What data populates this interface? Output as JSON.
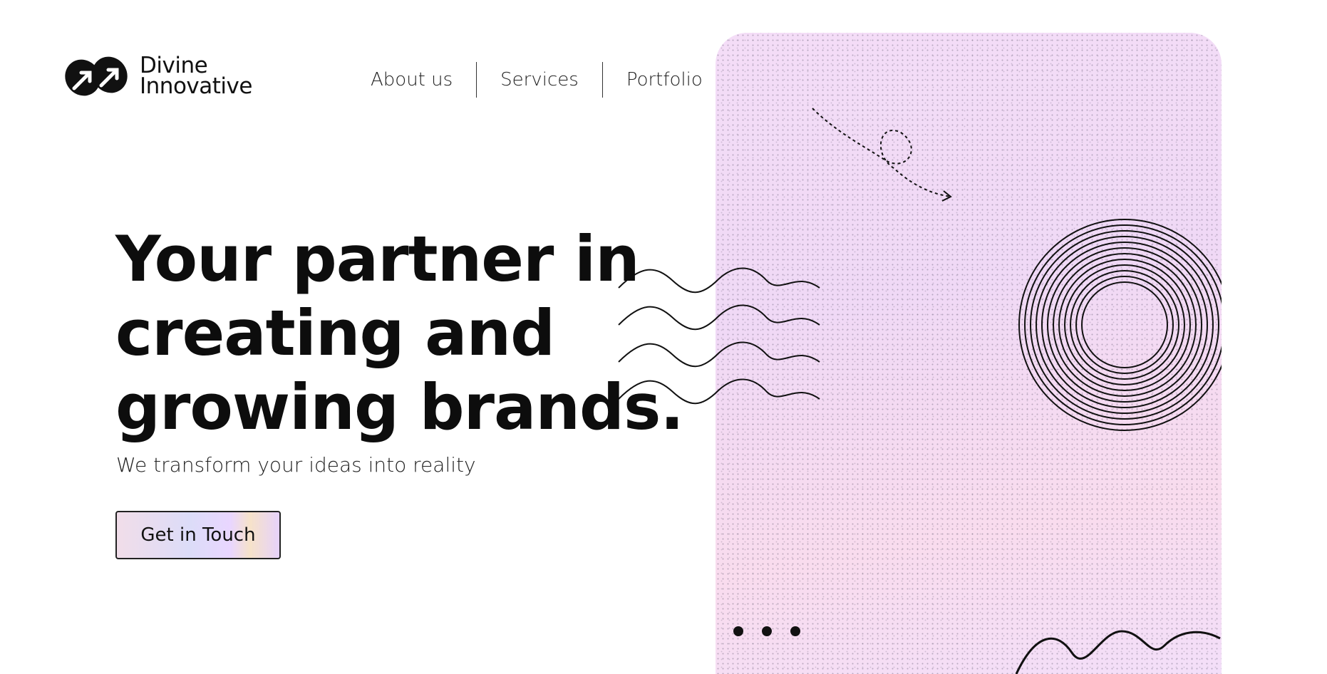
{
  "brand": {
    "name_line1": "Divine",
    "name_line2": "Innovative",
    "logo_icon": "linked-arrows-logo"
  },
  "nav": {
    "items": [
      {
        "label": "About us"
      },
      {
        "label": "Services"
      },
      {
        "label": "Portfolio"
      }
    ]
  },
  "hero": {
    "title_lines": [
      "Your partner in",
      "creating and",
      "growing brands."
    ],
    "subtitle": "We transform your ideas into reality",
    "cta_label": "Get in Touch"
  },
  "decor": {
    "panel_colors": [
      "#f4ddf7",
      "#f9dcee",
      "#f3dff9"
    ],
    "icons": [
      "dashed-loop-arrow-icon",
      "wavy-lines-icon",
      "concentric-circles-icon",
      "dots-icon",
      "wave-line-icon"
    ]
  },
  "colors": {
    "text": "#0d0d0d",
    "cta_border": "#222222",
    "background": "#ffffff"
  }
}
